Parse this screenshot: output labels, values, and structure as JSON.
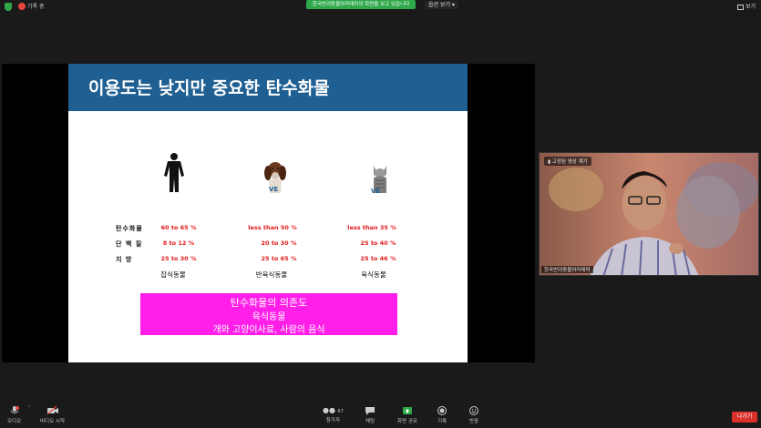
{
  "topbar": {
    "recording_label": "기록 중",
    "share_banner": "한국반려동물아카데미의 화면을 보고 있습니다",
    "view_options": "옵션 보기",
    "view_button": "보기"
  },
  "slide": {
    "title": "이용도는 낮지만 중요한 탄수화물",
    "rows": [
      {
        "label": "탄수화물",
        "values": [
          "60 to 65 %",
          "less than 50 %",
          "less than 35 %"
        ]
      },
      {
        "label": "단 백 질",
        "values": [
          "8 to 12 %",
          "20 to 30 %",
          "25 to 40 %"
        ]
      },
      {
        "label": "지   방",
        "values": [
          "25 to 30 %",
          "25 to 65 %",
          "25 to 46 %"
        ]
      }
    ],
    "categories": [
      "잡식동물",
      "반육식동물",
      "육식동물"
    ],
    "box_lines": [
      "탄수화물의 의존도",
      "육식동물",
      "개와 고양이사료, 사람의 음식"
    ]
  },
  "camera": {
    "tag": "고정된 영상 계기",
    "name": "한국반려동물아카데미"
  },
  "bottombar": {
    "audio": "오디오",
    "video": "비디오 시작",
    "participants": "참가자",
    "participants_count": "67",
    "chat": "채팅",
    "share": "화면 공유",
    "record": "기록",
    "reactions": "반응",
    "leave": "나가기"
  },
  "colors": {
    "header_blue": "#1f5f92",
    "value_red": "#e01b1b",
    "box_magenta": "#ff1fe8",
    "share_green": "#2ea84a",
    "leave_red": "#d9312a"
  }
}
